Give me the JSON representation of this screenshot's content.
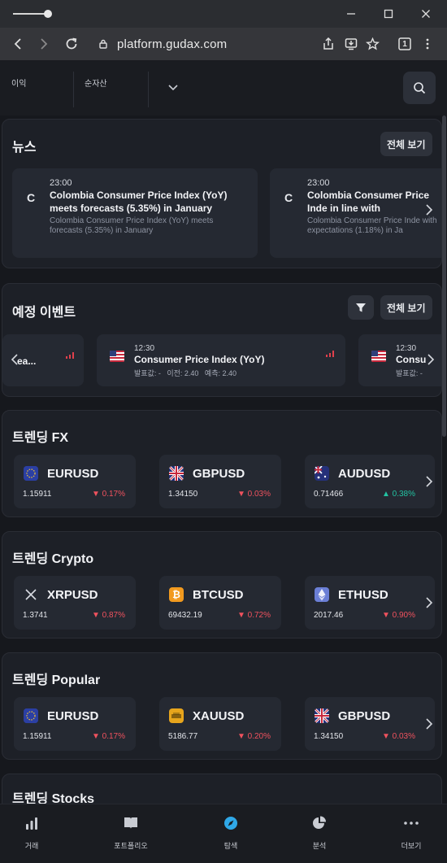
{
  "browser": {
    "url": "platform.gudax.com",
    "tab_count": "1"
  },
  "statbar": {
    "profit_label": "이익",
    "equity_label": "순자산"
  },
  "news": {
    "title": "뉴스",
    "view_all": "전체 보기",
    "items": [
      {
        "icon_letter": "C",
        "time": "23:00",
        "title": "Colombia Consumer Price Index (YoY) meets forecasts (5.35%) in January",
        "desc": "Colombia Consumer Price Index (YoY) meets forecasts (5.35%) in January"
      },
      {
        "icon_letter": "C",
        "time": "23:00",
        "title": "Colombia Consumer Price Inde in line with expectations (",
        "desc": "Colombia Consumer Price Inde with expectations (1.18%) in Ja"
      }
    ]
  },
  "events": {
    "title": "예정 이벤트",
    "view_all": "전체 보기",
    "partial_left": "ea...",
    "items": [
      {
        "time": "12:30",
        "title": "Consumer Price Index (YoY)",
        "meta": "발표값: -   이전: 2.40   예측: 2.40"
      },
      {
        "time": "12:30",
        "title": "Consu",
        "meta": "발표값: -"
      }
    ]
  },
  "sections": [
    {
      "title": "트렌딩 FX",
      "items": [
        {
          "symbol": "EURUSD",
          "price": "1.15911",
          "change": "0.17%",
          "dir": "down",
          "icon": "eu-flag-icon"
        },
        {
          "symbol": "GBPUSD",
          "price": "1.34150",
          "change": "0.03%",
          "dir": "down",
          "icon": "uk-flag-icon"
        },
        {
          "symbol": "AUDUSD",
          "price": "0.71466",
          "change": "0.38%",
          "dir": "up",
          "icon": "au-flag-icon"
        }
      ]
    },
    {
      "title": "트렌딩 Crypto",
      "items": [
        {
          "symbol": "XRPUSD",
          "price": "1.3741",
          "change": "0.87%",
          "dir": "down",
          "icon": "xrp-icon"
        },
        {
          "symbol": "BTCUSD",
          "price": "69432.19",
          "change": "0.72%",
          "dir": "down",
          "icon": "bitcoin-icon"
        },
        {
          "symbol": "ETHUSD",
          "price": "2017.46",
          "change": "0.90%",
          "dir": "down",
          "icon": "ethereum-icon"
        }
      ]
    },
    {
      "title": "트렌딩 Popular",
      "items": [
        {
          "symbol": "EURUSD",
          "price": "1.15911",
          "change": "0.17%",
          "dir": "down",
          "icon": "eu-flag-icon"
        },
        {
          "symbol": "XAUUSD",
          "price": "5186.77",
          "change": "0.20%",
          "dir": "down",
          "icon": "gold-icon"
        },
        {
          "symbol": "GBPUSD",
          "price": "1.34150",
          "change": "0.03%",
          "dir": "down",
          "icon": "uk-flag-icon"
        }
      ]
    },
    {
      "title": "트렌딩 Stocks",
      "items": []
    }
  ],
  "bottom_nav": [
    {
      "label": "거래",
      "icon": "bar-chart-icon"
    },
    {
      "label": "포트폴리오",
      "icon": "book-icon"
    },
    {
      "label": "탐색",
      "icon": "compass-icon",
      "active": true
    },
    {
      "label": "분석",
      "icon": "pie-chart-icon"
    },
    {
      "label": "더보기",
      "icon": "more-dots-icon"
    }
  ],
  "colors": {
    "accent": "#2fa8e8",
    "down": "#f0525e",
    "up": "#22c3a2",
    "background": "#16181d",
    "card": "#252932"
  }
}
